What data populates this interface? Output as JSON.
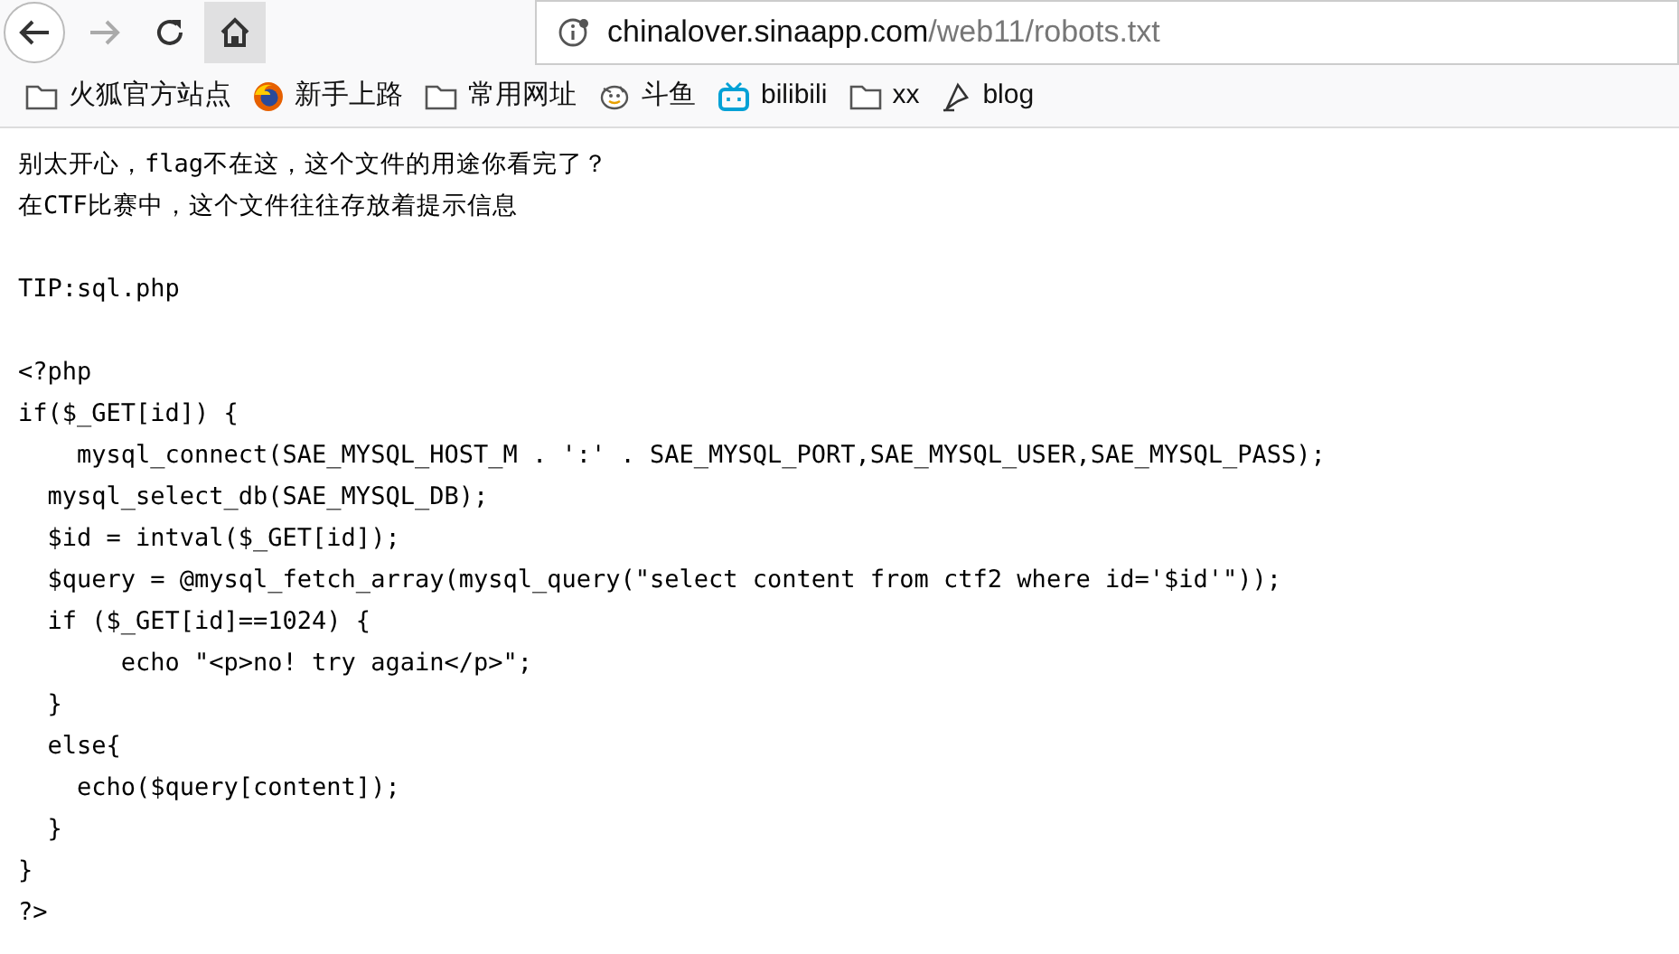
{
  "toolbar": {
    "back_disabled": false,
    "forward_disabled": true,
    "url_host": "chinalover.sinaapp.com",
    "url_path": "/web11/robots.txt"
  },
  "bookmarks": [
    {
      "kind": "folder",
      "label": "火狐官方站点"
    },
    {
      "kind": "firefox",
      "label": "新手上路"
    },
    {
      "kind": "folder",
      "label": "常用网址"
    },
    {
      "kind": "douyu",
      "label": "斗鱼"
    },
    {
      "kind": "bilibili",
      "label": "bilibili"
    },
    {
      "kind": "folder",
      "label": "xx"
    },
    {
      "kind": "blog",
      "label": "blog"
    }
  ],
  "blocks": [
    {
      "lines": [
        "别太开心，flag不在这，这个文件的用途你看完了？",
        "在CTF比赛中，这个文件往往存放着提示信息"
      ]
    },
    {
      "lines": [
        "TIP:sql.php"
      ]
    },
    {
      "lines": [
        "<?php",
        "if($_GET[id]) {",
        "    mysql_connect(SAE_MYSQL_HOST_M . ':' . SAE_MYSQL_PORT,SAE_MYSQL_USER,SAE_MYSQL_PASS);",
        "  mysql_select_db(SAE_MYSQL_DB);",
        "  $id = intval($_GET[id]);",
        "  $query = @mysql_fetch_array(mysql_query(\"select content from ctf2 where id='$id'\"));",
        "  if ($_GET[id]==1024) {",
        "       echo \"<p>no! try again</p>\";",
        "  }",
        "  else{",
        "    echo($query[content]);",
        "  }",
        "}",
        "?>"
      ]
    }
  ]
}
